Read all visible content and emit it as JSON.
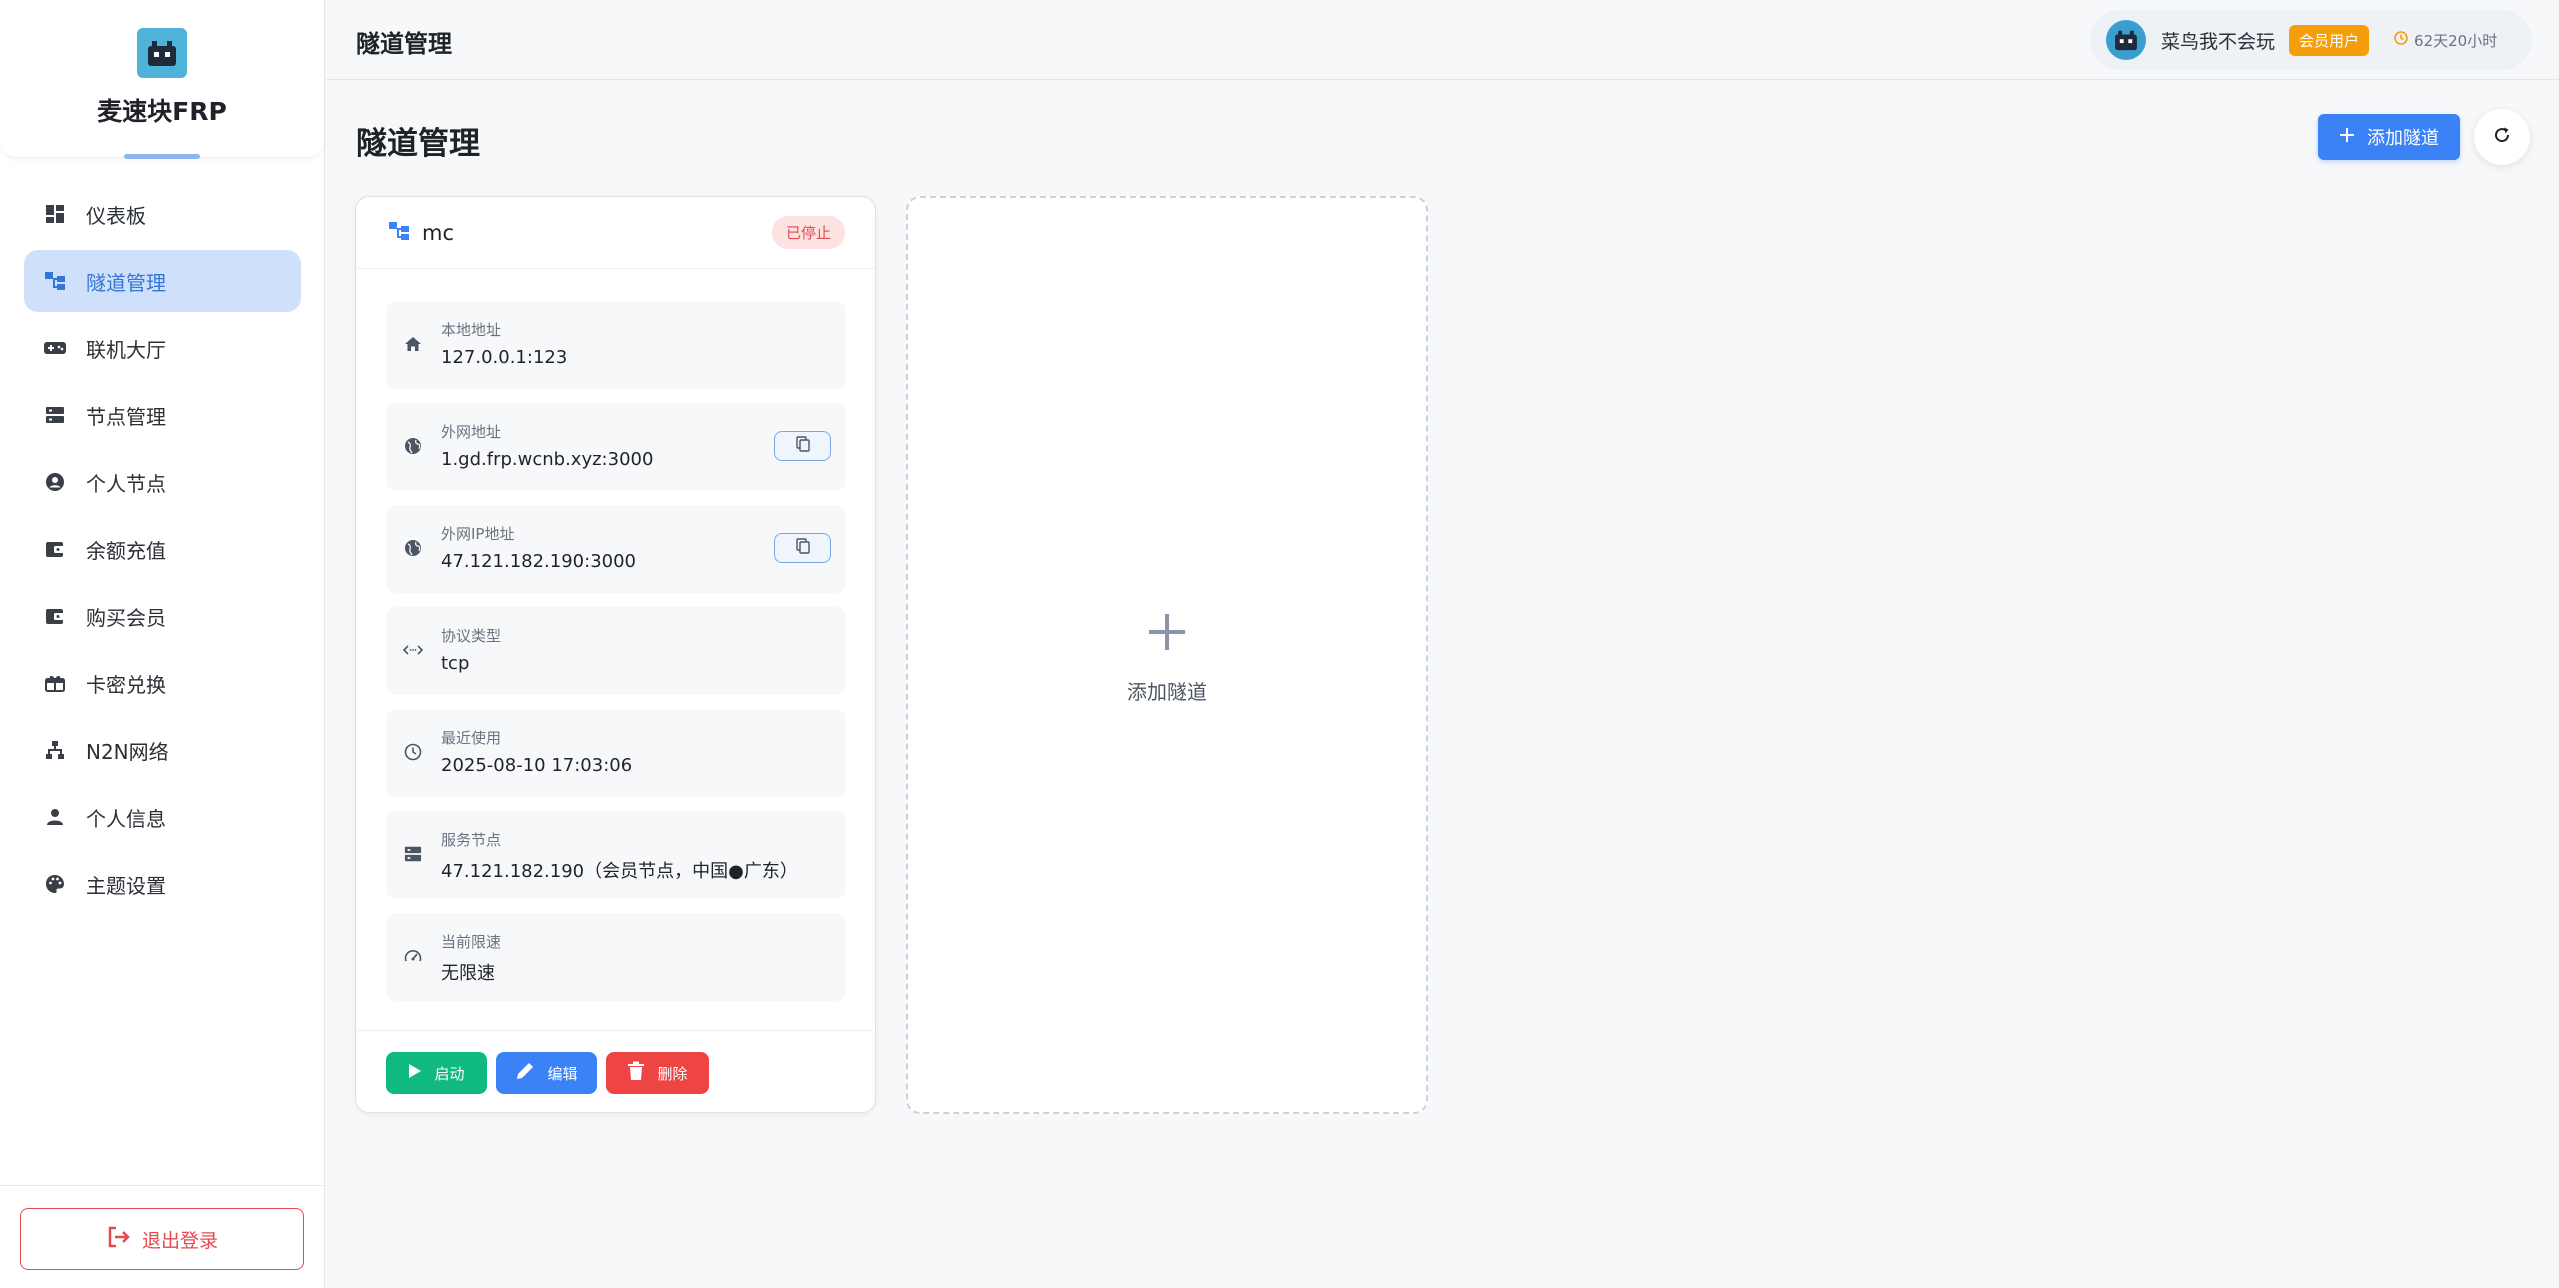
{
  "brand": {
    "name": "麦速块FRP"
  },
  "sidebar": {
    "items": [
      {
        "label": "仪表板",
        "icon": "dashboard-icon",
        "active": false
      },
      {
        "label": "隧道管理",
        "icon": "tunnel-icon",
        "active": true
      },
      {
        "label": "联机大厅",
        "icon": "gamepad-icon",
        "active": false
      },
      {
        "label": "节点管理",
        "icon": "server-icon",
        "active": false
      },
      {
        "label": "个人节点",
        "icon": "user-circle-icon",
        "active": false
      },
      {
        "label": "余额充值",
        "icon": "wallet-icon",
        "active": false
      },
      {
        "label": "购买会员",
        "icon": "wallet-icon",
        "active": false
      },
      {
        "label": "卡密兑换",
        "icon": "gift-icon",
        "active": false
      },
      {
        "label": "N2N网络",
        "icon": "network-icon",
        "active": false
      },
      {
        "label": "个人信息",
        "icon": "person-icon",
        "active": false
      },
      {
        "label": "主题设置",
        "icon": "palette-icon",
        "active": false
      }
    ],
    "logout_label": "退出登录"
  },
  "topbar": {
    "title": "隧道管理",
    "user_name": "菜鸟我不会玩",
    "badge": "会员用户",
    "expire": "62天20小时"
  },
  "main": {
    "title": "隧道管理",
    "add_button": "添加隧道",
    "tunnel": {
      "name": "mc",
      "status": "已停止",
      "fields": [
        {
          "label": "本地地址",
          "value": "127.0.0.1:123"
        },
        {
          "label": "外网地址",
          "value": "1.gd.frp.wcnb.xyz:3000"
        },
        {
          "label": "外网IP地址",
          "value": "47.121.182.190:3000"
        },
        {
          "label": "协议类型",
          "value": "tcp"
        },
        {
          "label": "最近使用",
          "value": "2025-08-10 17:03:06"
        },
        {
          "label": "服务节点",
          "value": "47.121.182.190（会员节点，中国●广东）"
        },
        {
          "label": "当前限速",
          "value": "无限速"
        }
      ],
      "actions": {
        "start": "启动",
        "edit": "编辑",
        "delete": "删除"
      }
    },
    "add_card_label": "添加隧道"
  },
  "colors": {
    "primary": "#3b82f6",
    "success": "#10b981",
    "danger": "#ef4444",
    "warning": "#f59e0b",
    "active_bg": "#cfe0fb"
  }
}
